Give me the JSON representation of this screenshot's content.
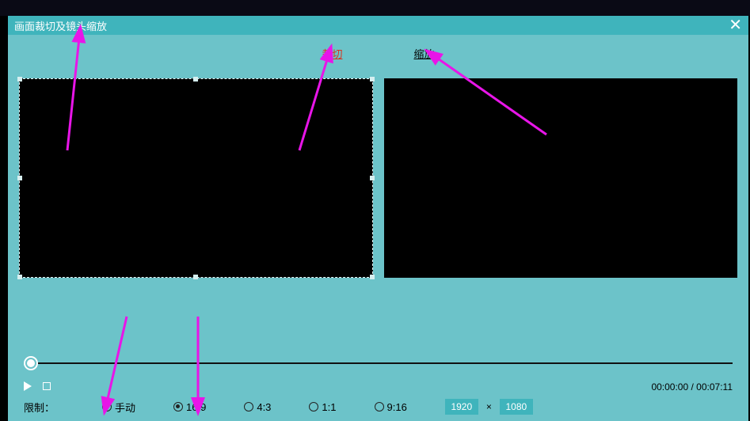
{
  "titlebar": {
    "title": "画面裁切及镜头缩放"
  },
  "tabs": {
    "crop": "裁切",
    "zoom": "缩放"
  },
  "playback": {
    "current": "00:00:00",
    "total": "00:07:11",
    "separator": " / "
  },
  "constraint": {
    "label": "限制：",
    "options": {
      "manual": "手动",
      "r16_9": "16:9",
      "r4_3": "4:3",
      "r1_1": "1:1",
      "r9_16": "9:16"
    },
    "width": "1920",
    "sep": "×",
    "height": "1080"
  }
}
